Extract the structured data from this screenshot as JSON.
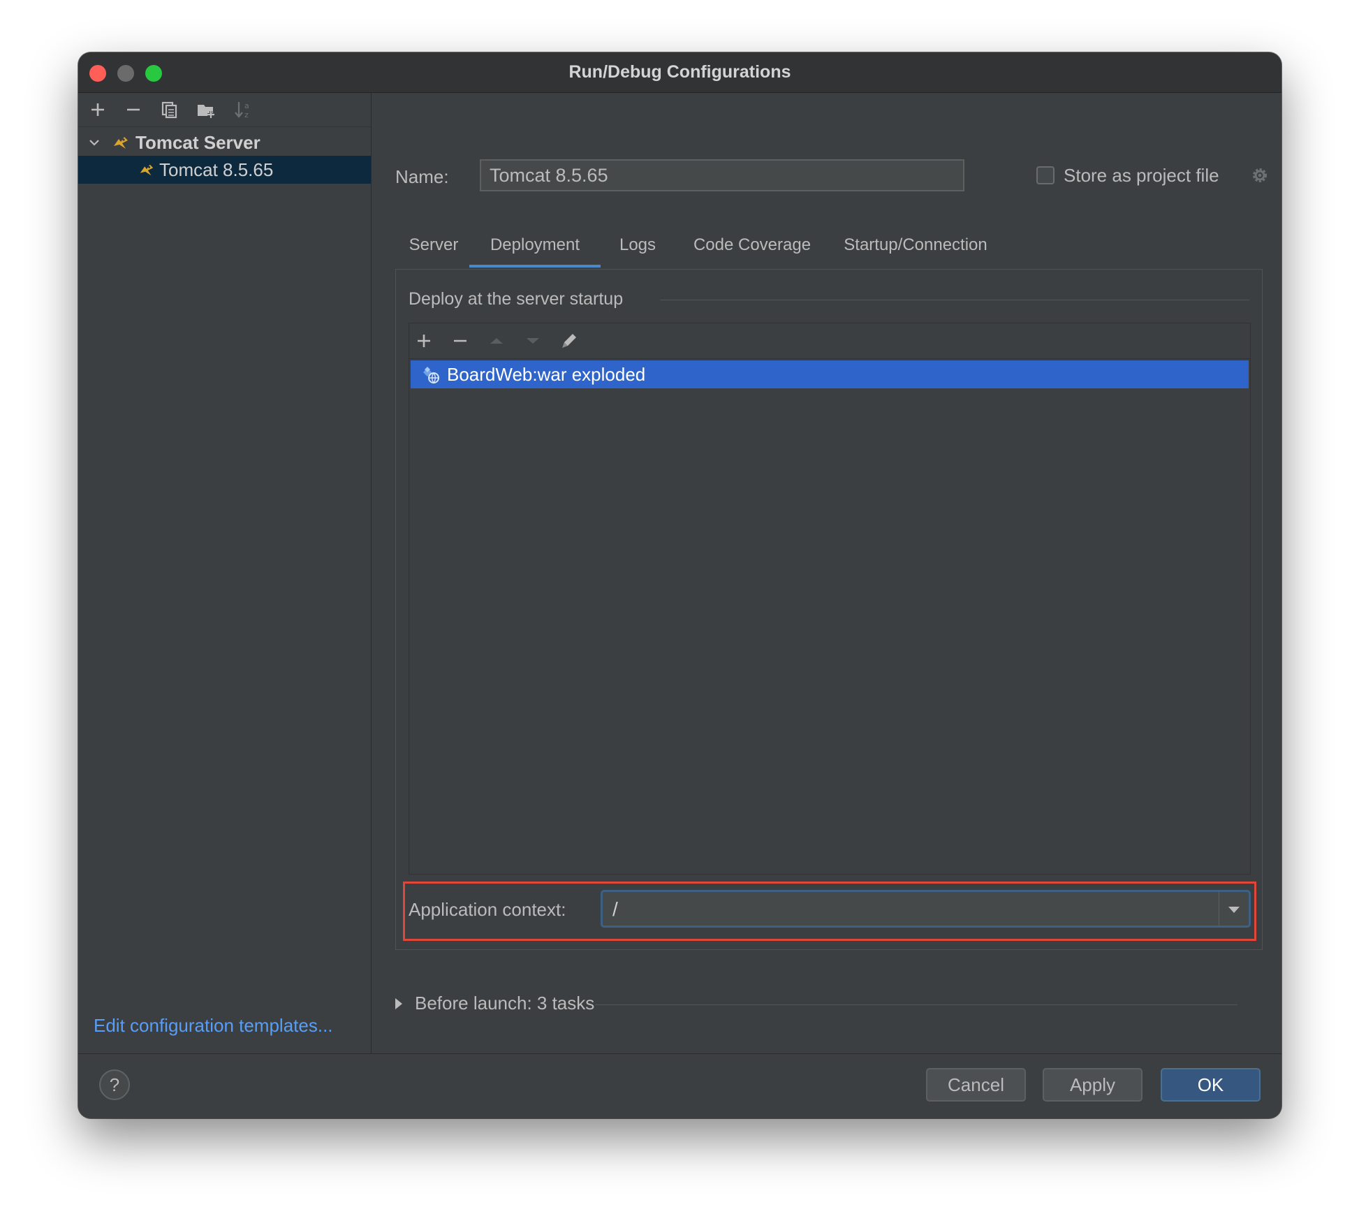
{
  "window": {
    "title": "Run/Debug Configurations"
  },
  "left_toolbar": {
    "icons": [
      "add-icon",
      "remove-icon",
      "copy-icon",
      "folder-add-icon",
      "sort-icon"
    ]
  },
  "tree": {
    "group_label": "Tomcat Server",
    "selected_item_label": "Tomcat 8.5.65"
  },
  "edit_templates_link": "Edit configuration templates...",
  "name": {
    "label": "Name:",
    "value": "Tomcat 8.5.65"
  },
  "store_as_project": {
    "label": "Store as project file",
    "checked": false
  },
  "tabs": [
    {
      "label": "Server",
      "active": false
    },
    {
      "label": "Deployment",
      "active": true
    },
    {
      "label": "Logs",
      "active": false
    },
    {
      "label": "Code Coverage",
      "active": false
    },
    {
      "label": "Startup/Connection",
      "active": false
    }
  ],
  "deployment": {
    "section_title": "Deploy at the server startup",
    "toolbar_icons": [
      "add-icon",
      "remove-icon",
      "move-up-icon",
      "move-down-icon",
      "edit-icon"
    ],
    "items": [
      {
        "label": "BoardWeb:war exploded",
        "selected": true
      }
    ],
    "application_context": {
      "label": "Application context:",
      "value": "/"
    }
  },
  "before_launch": {
    "label": "Before launch: 3 tasks"
  },
  "footer": {
    "help_label": "?",
    "cancel_label": "Cancel",
    "apply_label": "Apply",
    "ok_label": "OK"
  },
  "colors": {
    "background": "#3c3f41",
    "selection_blue": "#2f65ca",
    "tree_selection": "#0d293e",
    "link_blue": "#589df6",
    "ok_button": "#365880",
    "highlight_red": "#e0473b"
  }
}
